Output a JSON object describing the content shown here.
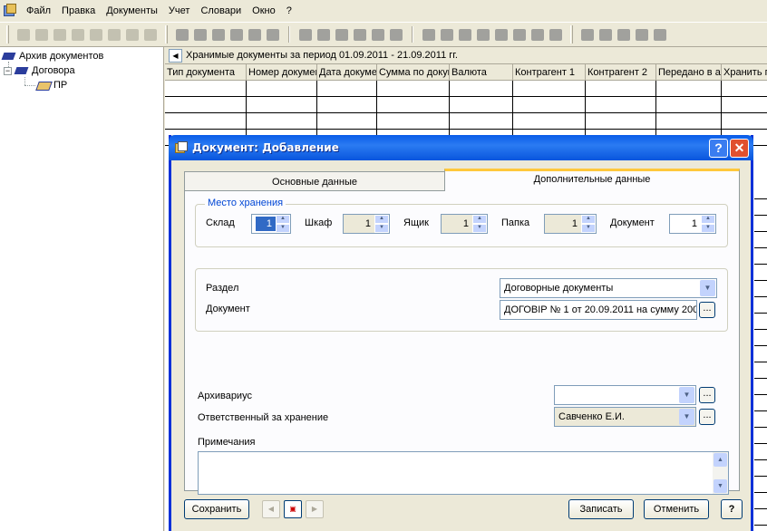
{
  "menu": {
    "items": [
      "Файл",
      "Правка",
      "Документы",
      "Учет",
      "Словари",
      "Окно",
      "?"
    ]
  },
  "tree": {
    "root": "Архив документов",
    "child": "Договора",
    "leaf": "ПР"
  },
  "main": {
    "period_title": "Хранимые документы за период 01.09.2011 - 21.09.2011 гг.",
    "columns": [
      "Тип документа",
      "Номер докумен",
      "Дата докуме",
      "Сумма по докуме",
      "Валюта",
      "Контрагент 1",
      "Контрагент 2",
      "Передано в а",
      "Хранить п"
    ]
  },
  "dialog": {
    "title": "Документ: Добавление",
    "help_label": "?",
    "close_label": "✕",
    "tabs": [
      "Основные данные",
      "Дополнительные данные"
    ],
    "storage": {
      "legend": "Место хранения",
      "warehouse_label": "Склад",
      "warehouse_value": "1",
      "cabinet_label": "Шкаф",
      "cabinet_value": "1",
      "box_label": "Ящик",
      "box_value": "1",
      "folder_label": "Папка",
      "folder_value": "1",
      "document_label": "Документ",
      "document_value": "1"
    },
    "section_label": "Раздел",
    "section_value": "Договорные документы",
    "document_label": "Документ",
    "document_value": "ДОГОВІР № 1 от 20.09.2011 на сумму 200",
    "archivist_label": "Архивариус",
    "archivist_value": "",
    "responsible_label": "Ответственный за хранение",
    "responsible_value": "Савченко Е.И.",
    "notes_label": "Примечания",
    "notes_value": "",
    "save_label": "Сохранить",
    "record_label": "Записать",
    "cancel_label": "Отменить",
    "help_button_label": "?"
  }
}
